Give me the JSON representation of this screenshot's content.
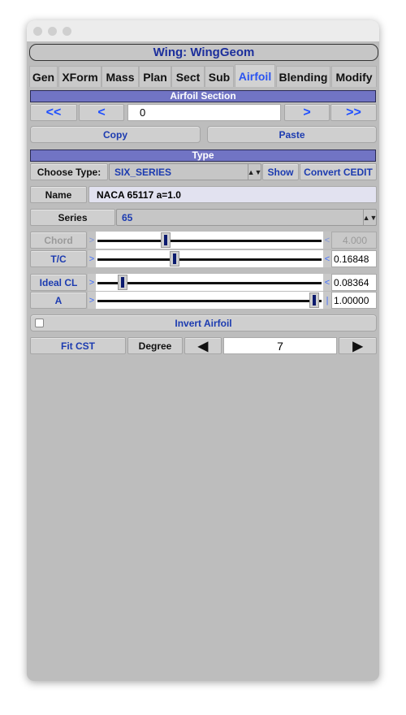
{
  "window": {
    "title": "Wing: WingGeom"
  },
  "tabs": [
    {
      "label": "Gen"
    },
    {
      "label": "XForm"
    },
    {
      "label": "Mass"
    },
    {
      "label": "Plan"
    },
    {
      "label": "Sect"
    },
    {
      "label": "Sub"
    },
    {
      "label": "Airfoil",
      "active": true
    },
    {
      "label": "Blending"
    },
    {
      "label": "Modify"
    }
  ],
  "airfoil_section": {
    "header": "Airfoil Section",
    "first": "<<",
    "prev": "<",
    "index": "0",
    "next": ">",
    "last": ">>",
    "copy": "Copy",
    "paste": "Paste"
  },
  "type": {
    "header": "Type",
    "choose_label": "Choose Type:",
    "selected": "SIX_SERIES",
    "show": "Show",
    "convert": "Convert CEDIT"
  },
  "name": {
    "label": "Name",
    "value": "NACA 65117  a=1.0"
  },
  "series": {
    "label": "Series",
    "selected": "65"
  },
  "sliders": [
    {
      "label": "Chord",
      "value": "4.000",
      "fraction": 0.3,
      "disabled": true,
      "left": ">",
      "right": "<"
    },
    {
      "label": "T/C",
      "value": "0.16848",
      "fraction": 0.34,
      "left": ">",
      "right": "<"
    },
    {
      "label": "Ideal CL",
      "value": "0.08364",
      "fraction": 0.1,
      "left": ">",
      "right": "<"
    },
    {
      "label": "A",
      "value": "1.00000",
      "fraction": 0.98,
      "left": ">",
      "right": "|"
    }
  ],
  "invert": {
    "label": "Invert Airfoil",
    "checked": false
  },
  "cst": {
    "fit": "Fit CST",
    "degree_label": "Degree",
    "degree": "7",
    "dec": "◀",
    "inc": "▶"
  },
  "colors": {
    "header": "#7174c4",
    "accent": "#1c3bb0",
    "active_tab": "#2b54f0"
  }
}
